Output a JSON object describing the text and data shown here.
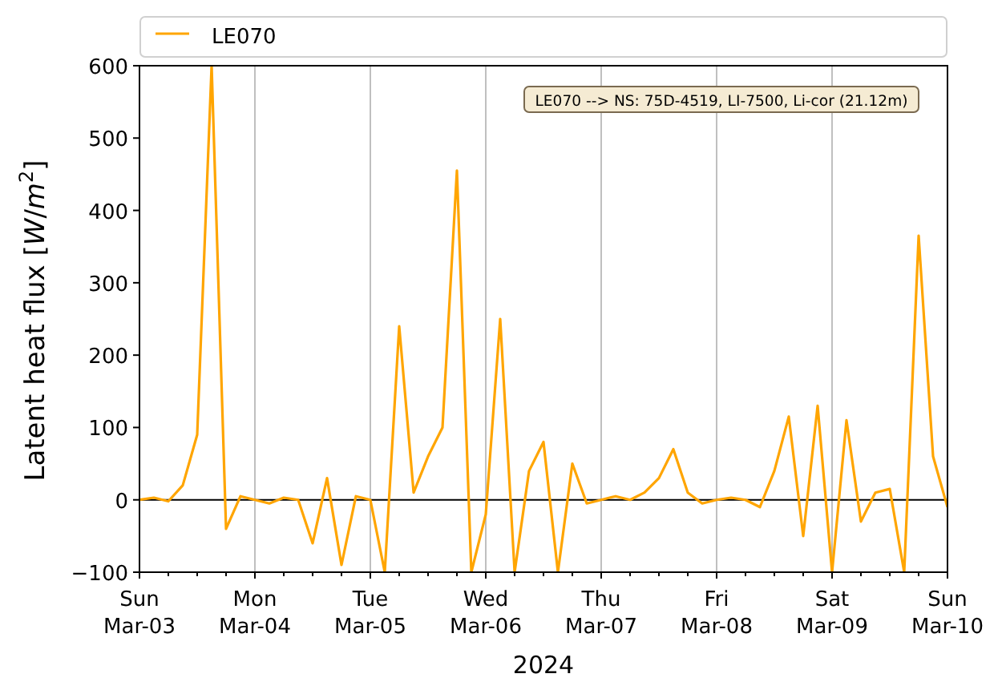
{
  "chart_data": {
    "type": "line",
    "grid": "x",
    "xlabel": "2024",
    "ylabel": "Latent heat flux [*W*/*m*$^{2}$]",
    "ylim": [
      -100,
      600
    ],
    "yticks": [
      -100,
      0,
      100,
      200,
      300,
      400,
      500,
      600
    ],
    "categories": [
      "Sun\nMar-03",
      null,
      null,
      null,
      null,
      null,
      null,
      null,
      "Mon\nMar-04",
      null,
      null,
      null,
      null,
      null,
      null,
      null,
      "Tue\nMar-05",
      null,
      null,
      null,
      null,
      null,
      null,
      null,
      "Wed\nMar-06",
      null,
      null,
      null,
      null,
      null,
      null,
      null,
      "Thu\nMar-07",
      null,
      null,
      null,
      null,
      null,
      null,
      null,
      "Fri\nMar-08",
      null,
      null,
      null,
      null,
      null,
      null,
      null,
      "Sat\nMar-09",
      null,
      null,
      null,
      null,
      null,
      null,
      null,
      "Sun\nMar-10"
    ],
    "series": [
      {
        "name": "LE070",
        "color": "#ffa500",
        "values": [
          0,
          3,
          -2,
          20,
          90,
          600,
          -40,
          5,
          0,
          -5,
          3,
          0,
          -60,
          30,
          -90,
          5,
          0,
          -100,
          240,
          10,
          60,
          100,
          455,
          -100,
          -20,
          250,
          -100,
          40,
          80,
          -100,
          50,
          -5,
          0,
          5,
          0,
          10,
          30,
          70,
          10,
          -5,
          0,
          3,
          0,
          -10,
          40,
          115,
          -50,
          130,
          -100,
          110,
          -30,
          10,
          15,
          -100,
          365,
          60,
          -10
        ]
      }
    ],
    "annotations": [
      {
        "text": "LE070 --> NS: 75D-4519, LI-7500, Li-cor (21.12m)"
      }
    ]
  }
}
